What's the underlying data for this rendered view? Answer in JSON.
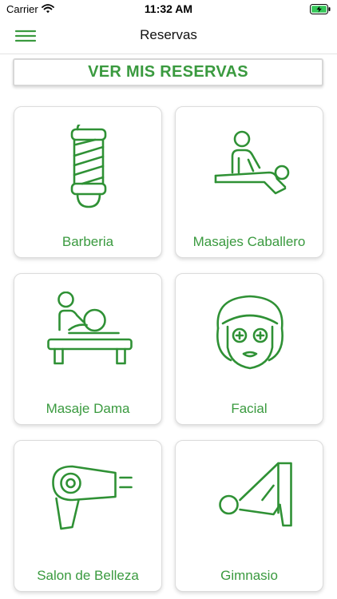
{
  "status_bar": {
    "carrier": "Carrier",
    "time": "11:32 AM"
  },
  "header": {
    "title": "Reservas",
    "menu_icon": "hamburger-menu-icon"
  },
  "banner": {
    "label": "VER MIS RESERVAS"
  },
  "categories": [
    {
      "label": "Barberia",
      "icon": "barber-pole-icon"
    },
    {
      "label": "Masajes Caballero",
      "icon": "massage-man-icon"
    },
    {
      "label": "Masaje Dama",
      "icon": "massage-woman-icon"
    },
    {
      "label": "Facial",
      "icon": "facial-mask-icon"
    },
    {
      "label": "Salon de Belleza",
      "icon": "hair-dryer-icon"
    },
    {
      "label": "Gimnasio",
      "icon": "yoga-pose-icon"
    }
  ],
  "colors": {
    "accent": "#3a9a3f",
    "icon_stroke": "#2f9135"
  }
}
